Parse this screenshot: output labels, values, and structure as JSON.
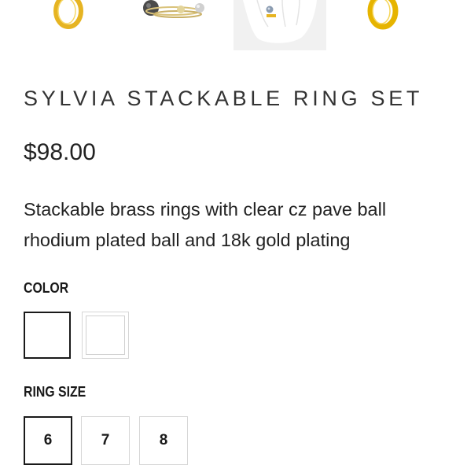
{
  "product": {
    "title": "SYLVIA STACKABLE RING SET",
    "price": "$98.00",
    "description": "Stackable brass rings with clear cz pave ball rhodium plated ball and 18k gold plating"
  },
  "thumbnails": [
    {
      "icon": "gold-ring-icon"
    },
    {
      "icon": "stacked-rings-icon"
    },
    {
      "icon": "hand-with-rings-icon"
    },
    {
      "icon": "gold-ring-icon"
    }
  ],
  "options": {
    "color": {
      "label": "COLOR",
      "selected_index": 0,
      "swatch_count": 2
    },
    "ring_size": {
      "label": "RING SIZE",
      "values": [
        "6",
        "7",
        "8"
      ],
      "selected": "6"
    }
  },
  "colors": {
    "text": "#222222",
    "selected_border": "#1a1a1a",
    "unselected_border": "#d6d6d6",
    "gold": "#e6b422",
    "thumb_background": "#f1f1f1"
  }
}
